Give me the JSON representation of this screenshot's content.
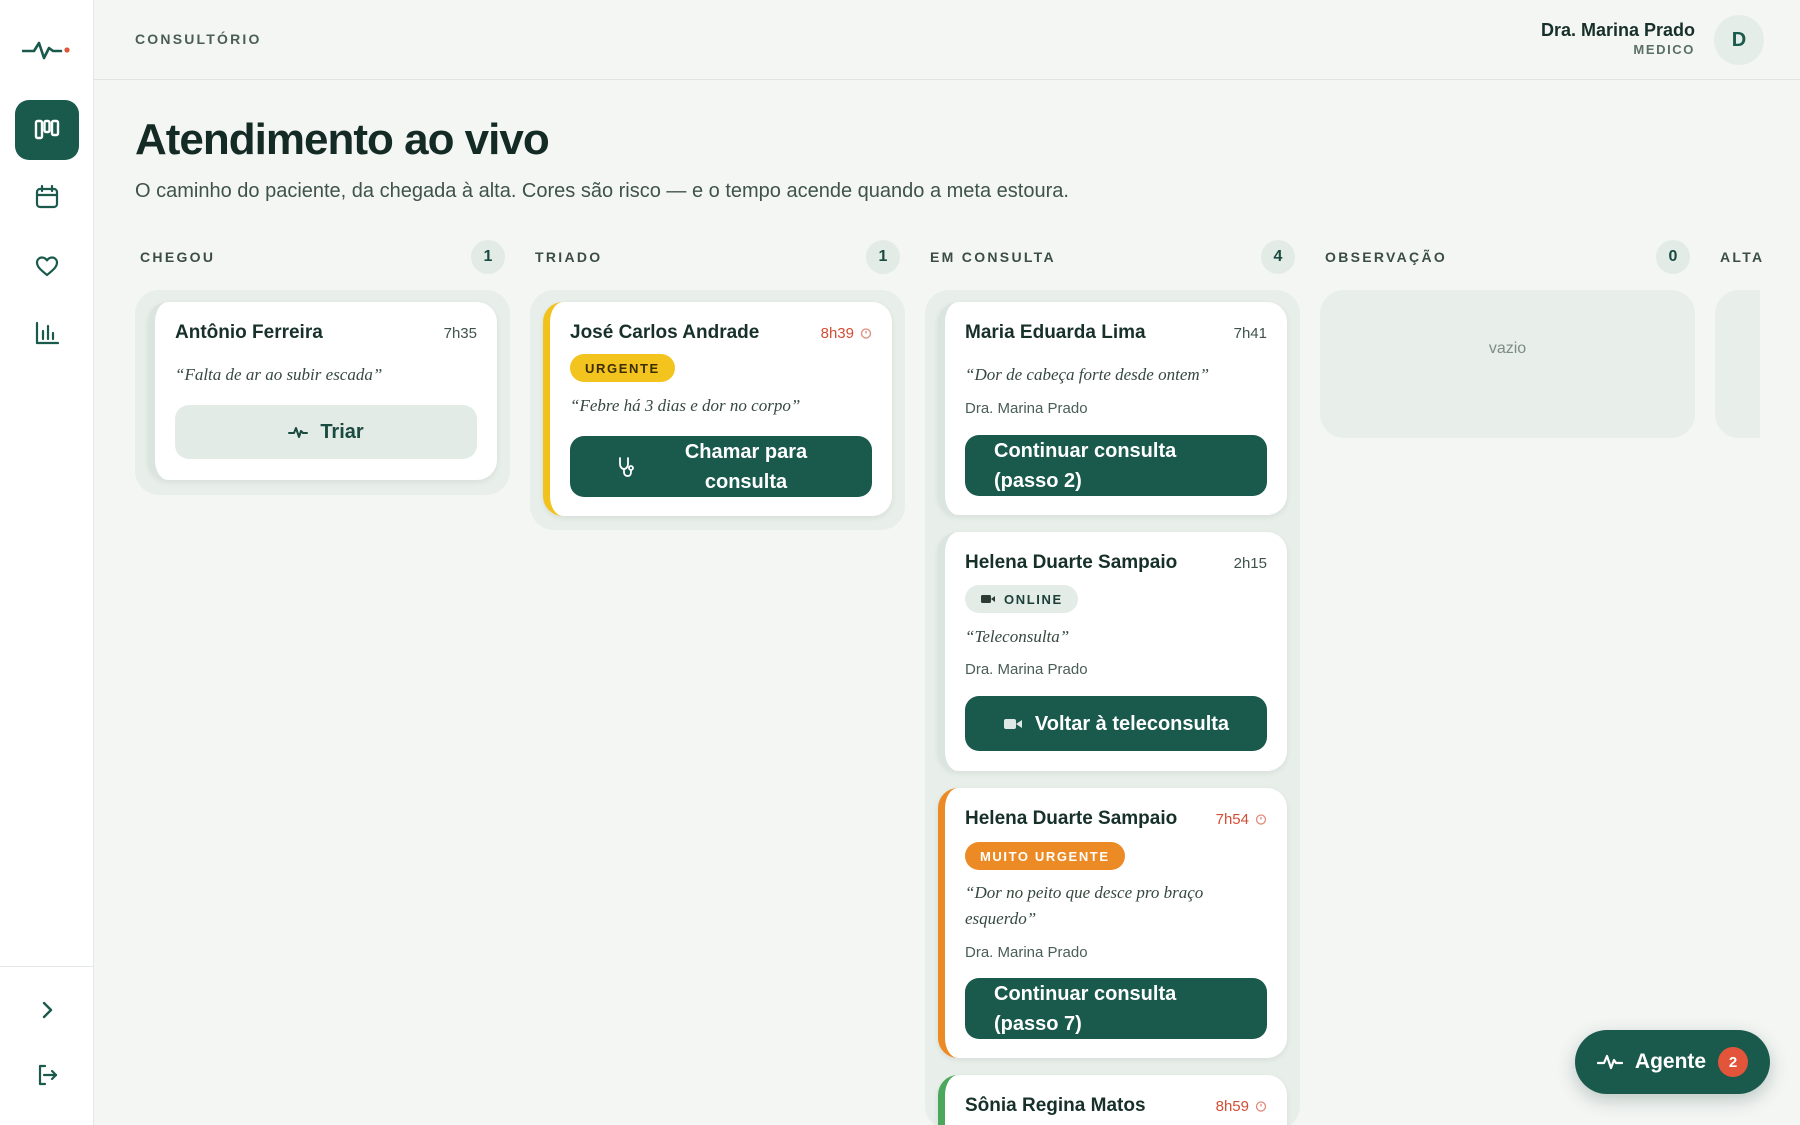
{
  "header": {
    "section": "CONSULTÓRIO",
    "user_name": "Dra. Marina Prado",
    "user_role": "MEDICO",
    "avatar_initial": "D"
  },
  "sidebar": {
    "items": [
      {
        "icon": "kanban-board-icon",
        "active": true
      },
      {
        "icon": "calendar-icon",
        "active": false
      },
      {
        "icon": "heart-icon",
        "active": false
      },
      {
        "icon": "bar-chart-icon",
        "active": false
      }
    ],
    "bottom": [
      {
        "icon": "chevron-right-icon"
      },
      {
        "icon": "logout-icon"
      }
    ]
  },
  "page": {
    "title": "Atendimento ao vivo",
    "subtitle": "O caminho do paciente, da chegada à alta. Cores são risco — e o tempo acende quando a meta estoura."
  },
  "columns": [
    {
      "title": "CHEGOU",
      "count": "1"
    },
    {
      "title": "TRIADO",
      "count": "1"
    },
    {
      "title": "EM CONSULTA",
      "count": "4"
    },
    {
      "title": "OBSERVAÇÃO",
      "count": "0"
    },
    {
      "title": "ALTA"
    }
  ],
  "empty_text": "vazio",
  "cards": {
    "chegou": [
      {
        "name": "Antônio Ferreira",
        "time": "7h35",
        "quote": "“Falta de ar ao subir escada”",
        "action": "Triar"
      }
    ],
    "triado": [
      {
        "name": "José Carlos Andrade",
        "time": "8h39",
        "badge": "URGENTE",
        "quote": "“Febre há 3 dias e dor no corpo”",
        "action": "Chamar para consulta"
      }
    ],
    "consulta": [
      {
        "name": "Maria Eduarda Lima",
        "time": "7h41",
        "quote": "“Dor de cabeça forte desde ontem”",
        "doctor": "Dra. Marina Prado",
        "action": "Continuar consulta (passo 2)"
      },
      {
        "name": "Helena Duarte Sampaio",
        "time": "2h15",
        "badge": "ONLINE",
        "quote": "“Teleconsulta”",
        "doctor": "Dra. Marina Prado",
        "action": "Voltar à teleconsulta"
      },
      {
        "name": "Helena Duarte Sampaio",
        "time": "7h54",
        "badge": "MUITO URGENTE",
        "quote": "“Dor no peito que desce pro braço esquerdo”",
        "doctor": "Dra. Marina Prado",
        "action": "Continuar consulta (passo 7)"
      },
      {
        "name": "Sônia Regina Matos",
        "time": "8h59"
      }
    ]
  },
  "fab": {
    "label": "Agente",
    "count": "2"
  },
  "colors": {
    "primary": "#1a5a4c",
    "risk_yellow": "#f1c21c",
    "risk_orange": "#ec8a25",
    "risk_green": "#4aa75c",
    "late_time": "#d24e34",
    "notification": "#e2553a"
  }
}
